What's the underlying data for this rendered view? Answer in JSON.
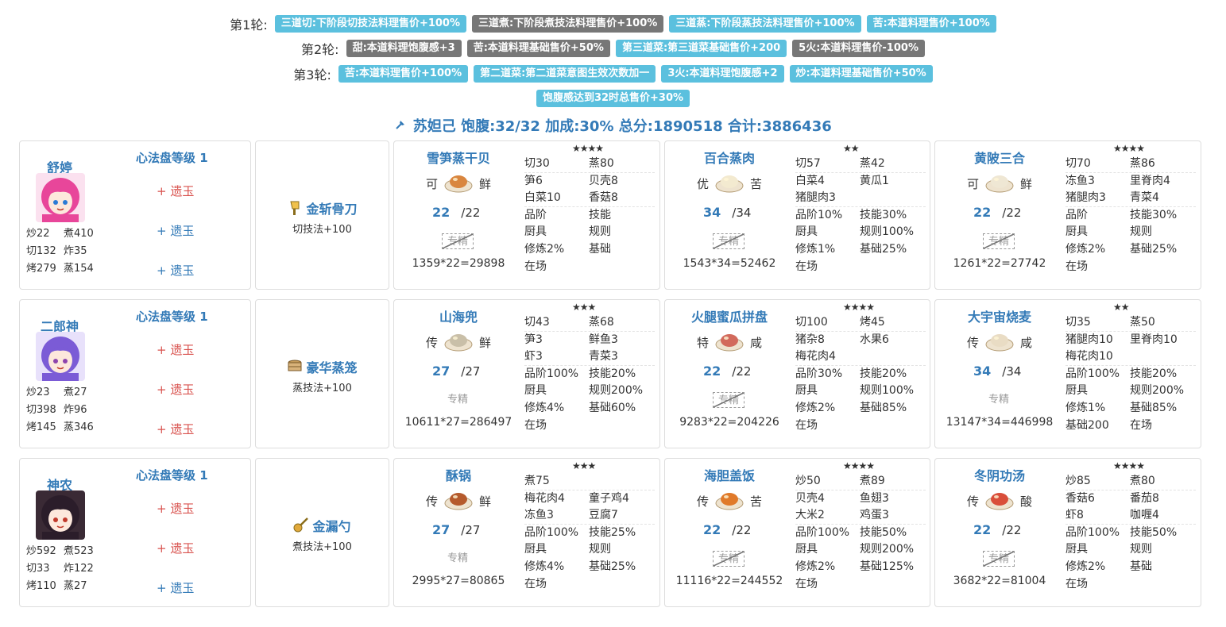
{
  "rounds": [
    {
      "label": "第1轮:",
      "tags": [
        {
          "text": "三道切:下阶段切技法料理售价+100%",
          "color": "blue"
        },
        {
          "text": "三道煮:下阶段煮技法料理售价+100%",
          "color": "gray"
        },
        {
          "text": "三道蒸:下阶段蒸技法料理售价+100%",
          "color": "blue"
        },
        {
          "text": "苦:本道料理售价+100%",
          "color": "blue"
        }
      ]
    },
    {
      "label": "第2轮:",
      "tags": [
        {
          "text": "甜:本道料理饱腹感+3",
          "color": "gray"
        },
        {
          "text": "苦:本道料理基础售价+50%",
          "color": "gray"
        },
        {
          "text": "第三道菜:第三道菜基础售价+200",
          "color": "blue"
        },
        {
          "text": "5火:本道料理售价-100%",
          "color": "gray"
        }
      ]
    },
    {
      "label": "第3轮:",
      "tags": [
        {
          "text": "苦:本道料理售价+100%",
          "color": "blue"
        },
        {
          "text": "第二道菜:第二道菜意图生效次数加一",
          "color": "blue"
        },
        {
          "text": "3火:本道料理饱腹感+2",
          "color": "blue"
        },
        {
          "text": "炒:本道料理基础售价+50%",
          "color": "blue"
        }
      ]
    },
    {
      "label": "",
      "tags": [
        {
          "text": "饱腹感达到32时总售价+30%",
          "color": "blue"
        }
      ]
    }
  ],
  "summary": {
    "text": "苏妲己 饱腹:32/32 加成:30% 总分:1890518 合计:3886436",
    "icon": "pin-icon"
  },
  "colors": {
    "accent": "#337ab7",
    "tag_blue": "#5bc0de",
    "tag_gray": "#777777",
    "relic_red": "#d9534f"
  },
  "rows": [
    {
      "chef": {
        "name": "舒婷",
        "xinfa": "心法盘等级 1",
        "stats": [
          [
            "炒22",
            "煮410"
          ],
          [
            "切132",
            "炸35"
          ],
          [
            "烤279",
            "蒸154"
          ]
        ],
        "relics": [
          {
            "text": "+ 遗玉",
            "color": "red"
          },
          {
            "text": "+ 遗玉",
            "color": "blue"
          },
          {
            "text": "+ 遗玉",
            "color": "blue"
          }
        ],
        "avatar": "pink-hair-chef-avatar"
      },
      "equip": {
        "name": "金斩骨刀",
        "skill": "切技法+100",
        "icon": "cleaver-icon"
      },
      "dishes": [
        {
          "name": "雪笋蒸干贝",
          "grade": "可",
          "taste": "鲜",
          "qty": "22",
          "qmax": "/22",
          "zhuanjing": "专精",
          "zj_active": false,
          "total": "1359*22=29898",
          "stars": "★★★★",
          "table": [
            [
              "切30",
              "蒸80"
            ],
            [
              "笋6",
              "贝壳8"
            ],
            [
              "白菜10",
              "香菇8"
            ],
            [
              "品阶",
              "技能"
            ],
            [
              "厨具",
              "规则"
            ],
            [
              "修炼2%",
              "基础"
            ],
            [
              "在场",
              ""
            ]
          ],
          "sep_after": 2
        },
        {
          "name": "百合蒸肉",
          "grade": "优",
          "taste": "苦",
          "qty": "34",
          "qmax": "/34",
          "zhuanjing": "专精",
          "zj_active": false,
          "total": "1543*34=52462",
          "stars": "★★",
          "table": [
            [
              "切57",
              "蒸42"
            ],
            [
              "白菜4",
              "黄瓜1"
            ],
            [
              "猪腿肉3",
              ""
            ],
            [
              "品阶10%",
              "技能30%"
            ],
            [
              "厨具",
              "规则100%"
            ],
            [
              "修炼1%",
              "基础25%"
            ],
            [
              "在场",
              ""
            ]
          ],
          "sep_after": 2
        },
        {
          "name": "黄陂三合",
          "grade": "可",
          "taste": "鲜",
          "qty": "22",
          "qmax": "/22",
          "zhuanjing": "专精",
          "zj_active": false,
          "total": "1261*22=27742",
          "stars": "★★★★",
          "table": [
            [
              "切70",
              "蒸86"
            ],
            [
              "冻鱼3",
              "里脊肉4"
            ],
            [
              "猪腿肉3",
              "青菜4"
            ],
            [
              "品阶",
              "技能30%"
            ],
            [
              "厨具",
              "规则"
            ],
            [
              "修炼2%",
              "基础25%"
            ],
            [
              "在场",
              ""
            ]
          ],
          "sep_after": 2
        }
      ]
    },
    {
      "chef": {
        "name": "二郎神",
        "xinfa": "心法盘等级 1",
        "stats": [
          [
            "炒23",
            "煮27"
          ],
          [
            "切398",
            "炸96"
          ],
          [
            "烤145",
            "蒸346"
          ]
        ],
        "relics": [
          {
            "text": "+ 遗玉",
            "color": "red"
          },
          {
            "text": "+ 遗玉",
            "color": "red"
          },
          {
            "text": "+ 遗玉",
            "color": "red"
          }
        ],
        "avatar": "purple-hair-chef-avatar"
      },
      "equip": {
        "name": "豪华蒸笼",
        "skill": "蒸技法+100",
        "icon": "steamer-icon"
      },
      "dishes": [
        {
          "name": "山海兜",
          "grade": "传",
          "taste": "鲜",
          "qty": "27",
          "qmax": "/27",
          "zhuanjing": "专精",
          "zj_active": true,
          "total": "10611*27=286497",
          "stars": "★★★",
          "table": [
            [
              "切43",
              "蒸68"
            ],
            [
              "笋3",
              "鲜鱼3"
            ],
            [
              "虾3",
              "青菜3"
            ],
            [
              "品阶100%",
              "技能20%"
            ],
            [
              "厨具",
              "规则200%"
            ],
            [
              "修炼4%",
              "基础60%"
            ],
            [
              "在场",
              ""
            ]
          ],
          "sep_after": 2
        },
        {
          "name": "火腿蜜瓜拼盘",
          "grade": "特",
          "taste": "咸",
          "qty": "22",
          "qmax": "/22",
          "zhuanjing": "专精",
          "zj_active": false,
          "total": "9283*22=204226",
          "stars": "★★★★",
          "table": [
            [
              "切100",
              "烤45"
            ],
            [
              "猪杂8",
              "水果6"
            ],
            [
              "梅花肉4",
              ""
            ],
            [
              "品阶30%",
              "技能20%"
            ],
            [
              "厨具",
              "规则100%"
            ],
            [
              "修炼2%",
              "基础85%"
            ],
            [
              "在场",
              ""
            ]
          ],
          "sep_after": 2
        },
        {
          "name": "大宇宙烧麦",
          "grade": "传",
          "taste": "咸",
          "qty": "34",
          "qmax": "/34",
          "zhuanjing": "专精",
          "zj_active": true,
          "total": "13147*34=446998",
          "stars": "★★",
          "table": [
            [
              "切35",
              "蒸50"
            ],
            [
              "猪腿肉10",
              "里脊肉10"
            ],
            [
              "梅花肉10",
              ""
            ],
            [
              "品阶100%",
              "技能20%"
            ],
            [
              "厨具",
              "规则200%"
            ],
            [
              "修炼1%",
              "基础85%"
            ],
            [
              "基础200",
              "在场"
            ]
          ],
          "sep_after": 2
        }
      ]
    },
    {
      "chef": {
        "name": "神农",
        "xinfa": "心法盘等级 1",
        "stats": [
          [
            "炒592",
            "煮523"
          ],
          [
            "切33",
            "炸122"
          ],
          [
            "烤110",
            "蒸27"
          ]
        ],
        "relics": [
          {
            "text": "+ 遗玉",
            "color": "red"
          },
          {
            "text": "+ 遗玉",
            "color": "red"
          },
          {
            "text": "+ 遗玉",
            "color": "blue"
          }
        ],
        "avatar": "dark-hair-chef-avatar"
      },
      "equip": {
        "name": "金漏勺",
        "skill": "煮技法+100",
        "icon": "ladle-icon"
      },
      "dishes": [
        {
          "name": "酥锅",
          "grade": "传",
          "taste": "鲜",
          "qty": "27",
          "qmax": "/27",
          "zhuanjing": "专精",
          "zj_active": true,
          "total": "2995*27=80865",
          "stars": "★★★",
          "table": [
            [
              "煮75",
              ""
            ],
            [
              "梅花肉4",
              "童子鸡4"
            ],
            [
              "冻鱼3",
              "豆腐7"
            ],
            [
              "品阶100%",
              "技能25%"
            ],
            [
              "厨具",
              "规则"
            ],
            [
              "修炼4%",
              "基础25%"
            ],
            [
              "在场",
              ""
            ]
          ],
          "sep_after": 0
        },
        {
          "name": "海胆盖饭",
          "grade": "传",
          "taste": "苦",
          "qty": "22",
          "qmax": "/22",
          "zhuanjing": "专精",
          "zj_active": false,
          "total": "11116*22=244552",
          "stars": "★★★★",
          "table": [
            [
              "炒50",
              "煮89"
            ],
            [
              "贝壳4",
              "鱼翅3"
            ],
            [
              "大米2",
              "鸡蛋3"
            ],
            [
              "品阶100%",
              "技能50%"
            ],
            [
              "厨具",
              "规则200%"
            ],
            [
              "修炼2%",
              "基础125%"
            ],
            [
              "在场",
              ""
            ]
          ],
          "sep_after": 2
        },
        {
          "name": "冬阴功汤",
          "grade": "传",
          "taste": "酸",
          "qty": "22",
          "qmax": "/22",
          "zhuanjing": "专精",
          "zj_active": false,
          "total": "3682*22=81004",
          "stars": "★★★★",
          "table": [
            [
              "炒85",
              "煮80"
            ],
            [
              "香菇6",
              "番茄8"
            ],
            [
              "虾8",
              "咖喱4"
            ],
            [
              "品阶100%",
              "技能50%"
            ],
            [
              "厨具",
              "规则"
            ],
            [
              "修炼2%",
              "基础"
            ],
            [
              "在场",
              ""
            ]
          ],
          "sep_after": 2
        }
      ]
    }
  ]
}
